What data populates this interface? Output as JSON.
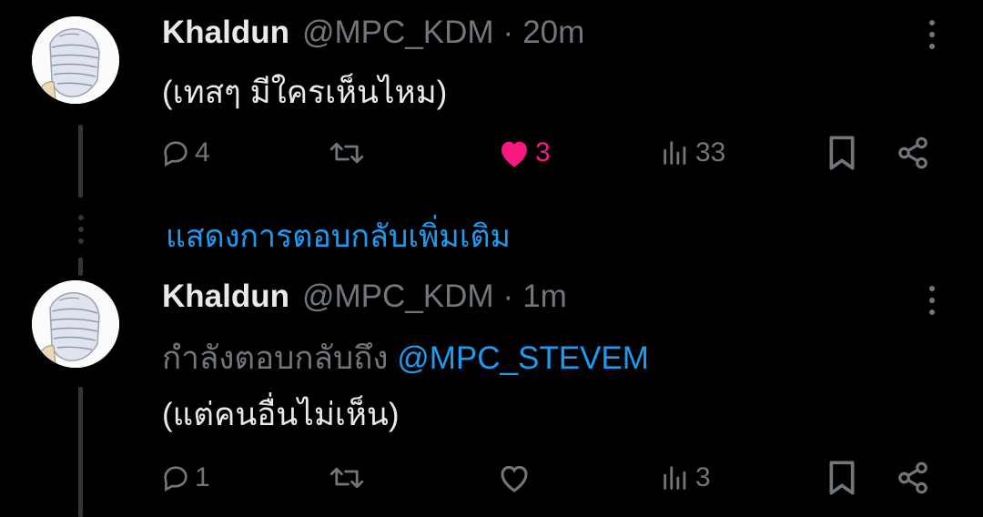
{
  "tweets": [
    {
      "name": "Khaldun",
      "handle": "@MPC_KDM",
      "sep": "·",
      "time": "20m",
      "text": "(เทสๆ มีใครเห็นไหม)",
      "replies": "4",
      "retweets": "",
      "likes": "3",
      "liked": true,
      "views": "33"
    },
    {
      "name": "Khaldun",
      "handle": "@MPC_KDM",
      "sep": "·",
      "time": "1m",
      "reply_prefix": "กำลังตอบกลับถึง",
      "reply_to": "@MPC_STEVEM",
      "text": "(แต่คนอื่นไม่เห็น)",
      "replies": "1",
      "retweets": "",
      "likes": "",
      "liked": false,
      "views": "3"
    }
  ],
  "show_more_replies": "แสดงการตอบกลับเพิ่มเติม",
  "colors": {
    "background": "#000000",
    "text": "#e7e9ea",
    "muted": "#71767b",
    "link": "#1d9bf0",
    "like": "#f91880"
  }
}
